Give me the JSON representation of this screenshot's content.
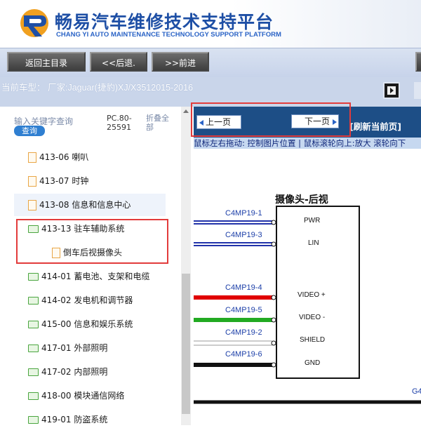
{
  "header": {
    "title_cn": "畅易汽车维修技术支持平台",
    "title_en": "CHANG YI AUTO MAINTENANCE TECHNOLOGY SUPPORT PLATFORM"
  },
  "toolbar": {
    "home_label": "返回主目录",
    "back_label": "<<后退.",
    "forward_label": ">>前进"
  },
  "vehicle": {
    "text": "当前车型： 厂家:Jaguar(捷豹)XJ/X3512015-2016"
  },
  "search": {
    "placeholder": "输入关键字查询",
    "button_label": "查询",
    "pc_info_1": "PC.80-",
    "pc_info_2": "25591",
    "fold_1": "折叠全",
    "fold_2": "部"
  },
  "tree": {
    "items": [
      {
        "label": "413-06 喇叭",
        "icon": "document-icon"
      },
      {
        "label": "413-07 时钟",
        "icon": "document-icon"
      },
      {
        "label": "413-08 信息和信息中心",
        "icon": "document-icon"
      },
      {
        "label": "413-13 驻车辅助系统",
        "icon": "folder-open-icon"
      },
      {
        "label": "倒车后视摄像头",
        "icon": "document-icon"
      },
      {
        "label": "414-01 蓄电池、支架和电缆",
        "icon": "folder-icon"
      },
      {
        "label": "414-02 发电机和调节器",
        "icon": "folder-icon"
      },
      {
        "label": "415-00 信息和娱乐系统",
        "icon": "folder-icon"
      },
      {
        "label": "417-01 外部照明",
        "icon": "folder-icon"
      },
      {
        "label": "417-02 内部照明",
        "icon": "folder-icon"
      },
      {
        "label": "418-00 模块通信网络",
        "icon": "folder-icon"
      },
      {
        "label": "419-01 防盗系统",
        "icon": "folder-icon"
      }
    ]
  },
  "viewer": {
    "prev_label": "上一页",
    "next_label": "下一页",
    "refresh_label": "[刷新当前页]",
    "hint": "鼠标左右拖动: 控制图片位置 | 鼠标滚轮向上:放大  滚轮向下"
  },
  "diagram": {
    "title": "摄像头-后视",
    "pins": [
      {
        "label": "C4MP19-1",
        "pin": "PWR",
        "color": "#2233aa"
      },
      {
        "label": "C4MP19-3",
        "pin": "LIN",
        "color": "#2233aa"
      },
      {
        "label": "C4MP19-4",
        "pin": "VIDEO +",
        "color": "#e00000"
      },
      {
        "label": "C4MP19-5",
        "pin": "VIDEO -",
        "color": "#22aa22"
      },
      {
        "label": "C4MP19-2",
        "pin": "SHIELD",
        "color": "#eeeeee"
      },
      {
        "label": "C4MP19-6",
        "pin": "GND",
        "color": "#111111"
      }
    ],
    "corner_label": "G4"
  },
  "colors": {
    "brand": "#1e4fa5",
    "highlight_box": "#e23b3b",
    "viewer_bar": "#1d4e86"
  }
}
